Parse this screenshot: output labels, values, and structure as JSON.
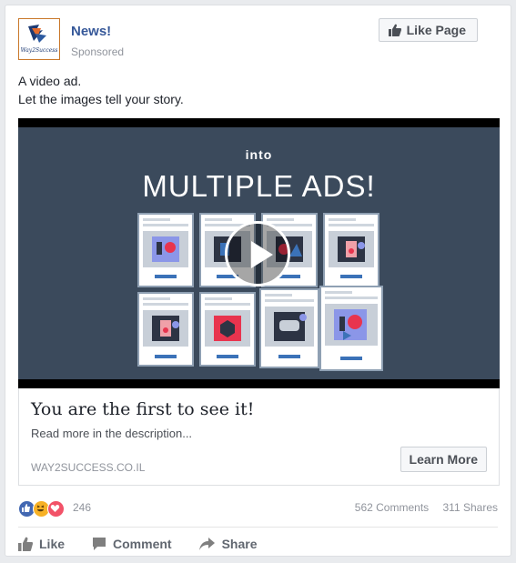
{
  "post": {
    "page_name": "News!",
    "sponsored": "Sponsored",
    "like_page_label": "Like Page",
    "text_line1": "A video ad.",
    "text_line2": "Let the images tell your story.",
    "logo_text": "Way2Success"
  },
  "video": {
    "into_text": "into",
    "headline": "MULTIPLE ADS!",
    "background_color": "#3b4a5c"
  },
  "link": {
    "title": "You are the first to see it!",
    "description": "Read more in the description...",
    "domain": "WAY2SUCCESS.CO.IL",
    "cta_label": "Learn More"
  },
  "stats": {
    "reactions": [
      "like-icon",
      "haha-icon",
      "love-icon"
    ],
    "reaction_count": "246",
    "comments": "562 Comments",
    "shares": "311 Shares"
  },
  "actions": {
    "like_label": "Like",
    "comment_label": "Comment",
    "share_label": "Share"
  },
  "colors": {
    "link_blue": "#365899",
    "like_blue": "#4267b2",
    "love_red": "#f25268",
    "haha_yellow": "#f7b125"
  }
}
